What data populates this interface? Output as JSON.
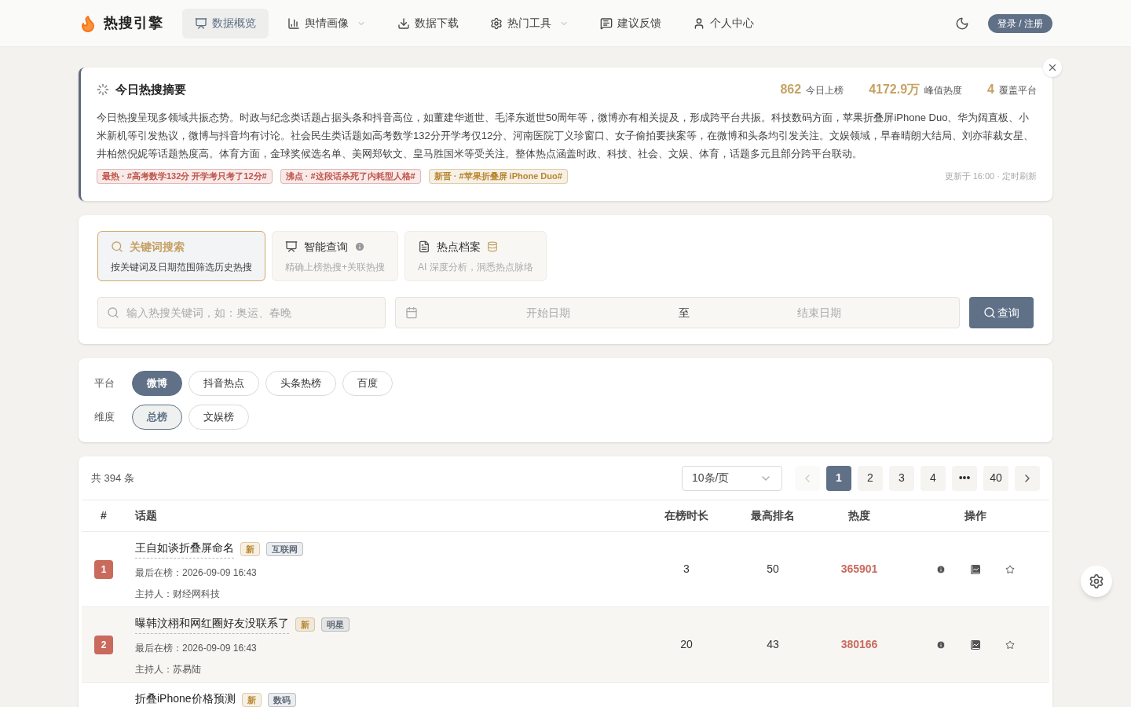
{
  "brand": {
    "name": "热搜引擎"
  },
  "nav": [
    {
      "label": "数据概览",
      "selected": true,
      "dropdown": false
    },
    {
      "label": "舆情画像",
      "selected": false,
      "dropdown": true
    },
    {
      "label": "数据下载",
      "selected": false,
      "dropdown": false
    },
    {
      "label": "热门工具",
      "selected": false,
      "dropdown": true
    },
    {
      "label": "建议反馈",
      "selected": false,
      "dropdown": false
    },
    {
      "label": "个人中心",
      "selected": false,
      "dropdown": false
    }
  ],
  "login_button": "登录 / 注册",
  "summary": {
    "title": "今日热搜摘要",
    "stats": [
      {
        "value": "862",
        "label": "今日上榜"
      },
      {
        "value": "4172.9万",
        "label": "峰值热度"
      },
      {
        "value": "4",
        "label": "覆盖平台"
      }
    ],
    "text": "今日热搜呈现多领域共振态势。时政与纪念类话题占据头条和抖音高位，如董建华逝世、毛泽东逝世50周年等，微博亦有相关提及，形成跨平台共振。科技数码方面，苹果折叠屏iPhone Duo、华为阔直板、小米新机等引发热议，微博与抖音均有讨论。社会民生类话题如高考数学132分开学考仅12分、河南医院丁义珍窗口、女子偷拍要挟案等，在微博和头条均引发关注。文娱领域，早春晴朗大结局、刘亦菲裁女星、井柏然倪妮等话题热度高。体育方面，金球奖候选名单、美网郑钦文、皇马胜国米等受关注。整体热点涵盖时政、科技、社会、文娱、体育，话题多元且部分跨平台联动。",
    "tags": [
      {
        "label": "最热 · #高考数学132分 开学考只考了12分#",
        "color": "#c0554a"
      },
      {
        "label": "沸点 · #这段话杀死了内耗型人格#",
        "color": "#c0554a"
      },
      {
        "label": "新晋 · #苹果折叠屏 iPhone Duo#",
        "color": "#b8862e"
      }
    ],
    "updated": "更新于 16:00 · 定时刷新"
  },
  "search_modes": [
    {
      "title": "关键词搜索",
      "subtitle": "按关键词及日期范围筛选历史热搜",
      "selected": true
    },
    {
      "title": "智能查询",
      "subtitle": "精确上榜热搜+关联热搜",
      "selected": false
    },
    {
      "title": "热点档案",
      "subtitle": "AI 深度分析，洞悉热点脉络",
      "selected": false
    }
  ],
  "keyword_field": {
    "placeholder": "输入热搜关键词，如：奥运、春晚"
  },
  "date_range": {
    "start_placeholder": "开始日期",
    "separator": "至",
    "end_placeholder": "结束日期"
  },
  "query_button": "查询",
  "filters": [
    {
      "label": "平台",
      "kind": "filled",
      "options": [
        {
          "label": "微博",
          "selected": true
        },
        {
          "label": "抖音热点",
          "selected": false
        },
        {
          "label": "头条热榜",
          "selected": false
        },
        {
          "label": "百度",
          "selected": false
        }
      ]
    },
    {
      "label": "维度",
      "kind": "outlined",
      "options": [
        {
          "label": "总榜",
          "selected": true
        },
        {
          "label": "文娱榜",
          "selected": false
        }
      ]
    }
  ],
  "table": {
    "total": "共 394 条",
    "page_size": "10条/页",
    "pages": [
      {
        "label": "1",
        "selected": true
      },
      {
        "label": "2",
        "selected": false
      },
      {
        "label": "3",
        "selected": false
      },
      {
        "label": "4",
        "selected": false
      },
      {
        "label": "•••",
        "selected": false
      },
      {
        "label": "40",
        "selected": false
      }
    ],
    "prev_disabled": true,
    "columns": [
      "#",
      "话题",
      "在榜时长",
      "最高排名",
      "热度",
      "操作"
    ],
    "rows": [
      {
        "rank": "1",
        "topic": "王自如谈折叠屏命名",
        "tags": [
          {
            "label": "新",
            "color": "#b8862e"
          },
          {
            "label": "互联网",
            "color": "#5f6b7a"
          }
        ],
        "last_seen": "最后在榜：2026-09-09 16:43",
        "host": "主持人：财经网科技",
        "duration": "3",
        "best_rank": "50",
        "heat": "365901",
        "highlighted": false
      },
      {
        "rank": "2",
        "topic": "曝韩汶栩和网红圈好友没联系了",
        "tags": [
          {
            "label": "新",
            "color": "#b8862e"
          },
          {
            "label": "明星",
            "color": "#5f6b7a"
          }
        ],
        "last_seen": "最后在榜：2026-09-09 16:43",
        "host": "主持人：苏易陆",
        "duration": "20",
        "best_rank": "43",
        "heat": "380166",
        "highlighted": true
      },
      {
        "topic": "折叠iPhone价格预测",
        "tags": [
          {
            "label": "新",
            "color": "#b8862e"
          },
          {
            "label": "数码",
            "color": "#5f6b7a"
          }
        ],
        "highlighted": false
      }
    ]
  }
}
